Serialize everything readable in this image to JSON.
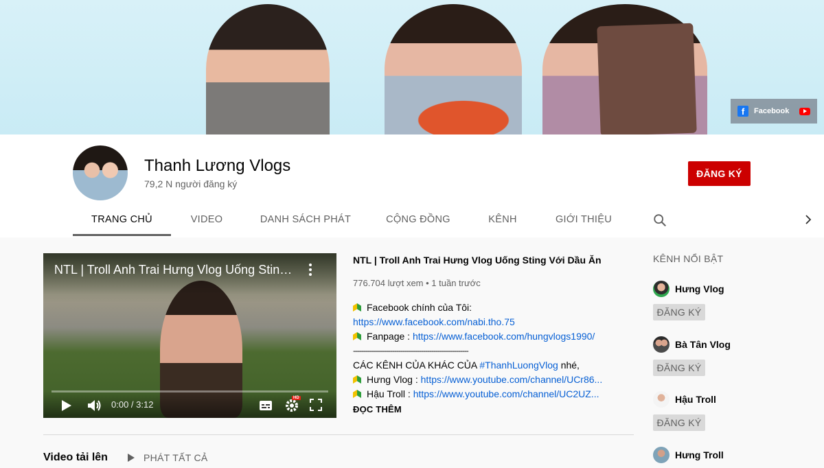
{
  "banner": {
    "links": [
      {
        "label": "Facebook",
        "icon": "facebook-icon"
      },
      {
        "label": "",
        "icon": "youtube-icon"
      }
    ]
  },
  "channel": {
    "name": "Thanh Lương Vlogs",
    "subscribers": "79,2 N người đăng ký",
    "subscribe_label": "ĐĂNG KÝ"
  },
  "tabs": [
    {
      "label": "TRANG CHỦ",
      "active": true
    },
    {
      "label": "VIDEO",
      "active": false
    },
    {
      "label": "DANH SÁCH PHÁT",
      "active": false
    },
    {
      "label": "CỘNG ĐỒNG",
      "active": false
    },
    {
      "label": "KÊNH",
      "active": false
    },
    {
      "label": "GIỚI THIỆU",
      "active": false
    }
  ],
  "featured_video": {
    "overlay_title": "NTL | Troll Anh Trai Hưng Vlog Uống Sting...",
    "time": "0:00 / 3:12",
    "hd_badge": "HD",
    "title": "NTL | Troll Anh Trai Hưng Vlog Uống Sting Với Dầu Ăn",
    "meta": "776.704 lượt xem • 1 tuần trước",
    "description": {
      "line1": "Facebook chính của Tôi:",
      "line2_link": "https://www.facebook.com/nabi.tho.75",
      "line3_label": "Fanpage : ",
      "line3_link": "https://www.facebook.com/hungvlogs1990/",
      "divider": "--------------------------------------------------------",
      "line5_text": "CÁC KÊNH CỦA KHÁC CỦA ",
      "line5_hashtag": "#ThanhLuongVlog",
      "line5_suffix": " nhé,",
      "line6_label": "Hưng Vlog : ",
      "line6_link": "https://www.youtube.com/channel/UCr86...",
      "line7_label": "Hậu Troll : ",
      "line7_link": "https://www.youtube.com/channel/UC2UZ..."
    },
    "read_more": "ĐỌC THÊM"
  },
  "uploads": {
    "title": "Video tải lên",
    "play_all": "PHÁT TẤT CẢ"
  },
  "featured_channels": {
    "heading": "KÊNH NỔI BẬT",
    "subscribe_label": "ĐĂNG KÝ",
    "items": [
      {
        "name": "Hưng Vlog"
      },
      {
        "name": "Bà Tân Vlog"
      },
      {
        "name": "Hậu Troll"
      },
      {
        "name": "Hưng Troll"
      }
    ]
  },
  "colors": {
    "subscribe_red": "#cc0000",
    "link_blue": "#065fd4",
    "banner_bg": "#d8f1f8"
  }
}
